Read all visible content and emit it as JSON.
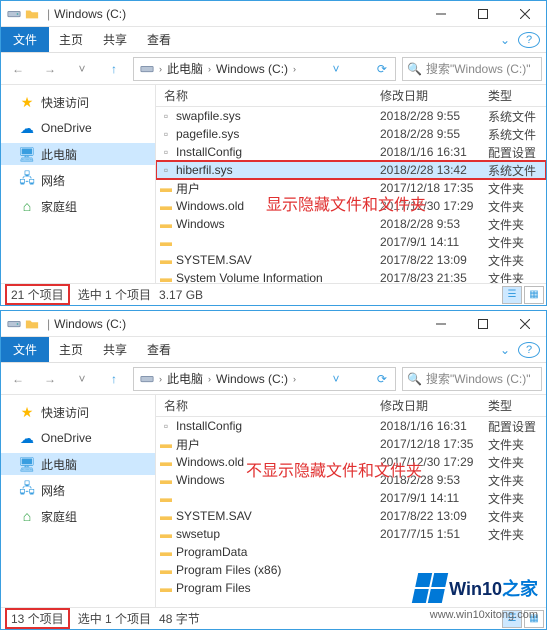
{
  "win1": {
    "title": "Windows (C:)",
    "menu": {
      "file": "文件",
      "home": "主页",
      "share": "共享",
      "view": "查看"
    },
    "breadcrumb": {
      "pc": "此电脑",
      "drive": "Windows (C:)"
    },
    "search_placeholder": "搜索\"Windows (C:)\"",
    "sidebar": [
      {
        "label": "快速访问",
        "icon": "star"
      },
      {
        "label": "OneDrive",
        "icon": "cloud"
      },
      {
        "label": "此电脑",
        "icon": "pc",
        "selected": true
      },
      {
        "label": "网络",
        "icon": "net"
      },
      {
        "label": "家庭组",
        "icon": "home"
      }
    ],
    "columns": {
      "name": "名称",
      "date": "修改日期",
      "type": "类型"
    },
    "files": [
      {
        "name": "swapfile.sys",
        "date": "2018/2/28 9:55",
        "type": "系统文件",
        "kind": "file"
      },
      {
        "name": "pagefile.sys",
        "date": "2018/2/28 9:55",
        "type": "系统文件",
        "kind": "file"
      },
      {
        "name": "InstallConfig",
        "date": "2018/1/16 16:31",
        "type": "配置设置",
        "kind": "file"
      },
      {
        "name": "hiberfil.sys",
        "date": "2018/2/28 13:42",
        "type": "系统文件",
        "kind": "file",
        "selected": true,
        "highlighted": true
      },
      {
        "name": "用户",
        "date": "2017/12/18 17:35",
        "type": "文件夹",
        "kind": "folder"
      },
      {
        "name": "Windows.old",
        "date": "2017/12/30 17:29",
        "type": "文件夹",
        "kind": "folder"
      },
      {
        "name": "Windows",
        "date": "2018/2/28 9:53",
        "type": "文件夹",
        "kind": "folder"
      },
      {
        "name": "",
        "date": "2017/9/1 14:11",
        "type": "文件夹",
        "kind": "folder"
      },
      {
        "name": "SYSTEM.SAV",
        "date": "2017/8/22 13:09",
        "type": "文件夹",
        "kind": "folder"
      },
      {
        "name": "System Volume Information",
        "date": "2017/8/23 21:35",
        "type": "文件夹",
        "kind": "folder"
      }
    ],
    "annotation": "显示隐藏文件和文件夹",
    "status": {
      "count": "21 个项目",
      "selection": "选中 1 个项目",
      "size": "3.17 GB"
    }
  },
  "win2": {
    "title": "Windows (C:)",
    "menu": {
      "file": "文件",
      "home": "主页",
      "share": "共享",
      "view": "查看"
    },
    "breadcrumb": {
      "pc": "此电脑",
      "drive": "Windows (C:)"
    },
    "search_placeholder": "搜索\"Windows (C:)\"",
    "sidebar": [
      {
        "label": "快速访问",
        "icon": "star"
      },
      {
        "label": "OneDrive",
        "icon": "cloud"
      },
      {
        "label": "此电脑",
        "icon": "pc",
        "selected": true
      },
      {
        "label": "网络",
        "icon": "net"
      },
      {
        "label": "家庭组",
        "icon": "home"
      }
    ],
    "columns": {
      "name": "名称",
      "date": "修改日期",
      "type": "类型"
    },
    "files": [
      {
        "name": "InstallConfig",
        "date": "2018/1/16 16:31",
        "type": "配置设置",
        "kind": "file"
      },
      {
        "name": "用户",
        "date": "2017/12/18 17:35",
        "type": "文件夹",
        "kind": "folder"
      },
      {
        "name": "Windows.old",
        "date": "2017/12/30 17:29",
        "type": "文件夹",
        "kind": "folder"
      },
      {
        "name": "Windows",
        "date": "2018/2/28 9:53",
        "type": "文件夹",
        "kind": "folder"
      },
      {
        "name": "",
        "date": "2017/9/1 14:11",
        "type": "文件夹",
        "kind": "folder"
      },
      {
        "name": "SYSTEM.SAV",
        "date": "2017/8/22 13:09",
        "type": "文件夹",
        "kind": "folder"
      },
      {
        "name": "swsetup",
        "date": "2017/7/15 1:51",
        "type": "文件夹",
        "kind": "folder"
      },
      {
        "name": "ProgramData",
        "date": "",
        "type": "",
        "kind": "folder"
      },
      {
        "name": "Program Files (x86)",
        "date": "",
        "type": "",
        "kind": "folder"
      },
      {
        "name": "Program Files",
        "date": "",
        "type": "",
        "kind": "folder"
      }
    ],
    "annotation": "不显示隐藏文件和文件夹",
    "status": {
      "count": "13 个项目",
      "selection": "选中 1 个项目",
      "size": "48 字节"
    }
  },
  "watermark": {
    "brand": "Win10",
    "suffix": "之家",
    "url": "www.win10xitong.com"
  }
}
